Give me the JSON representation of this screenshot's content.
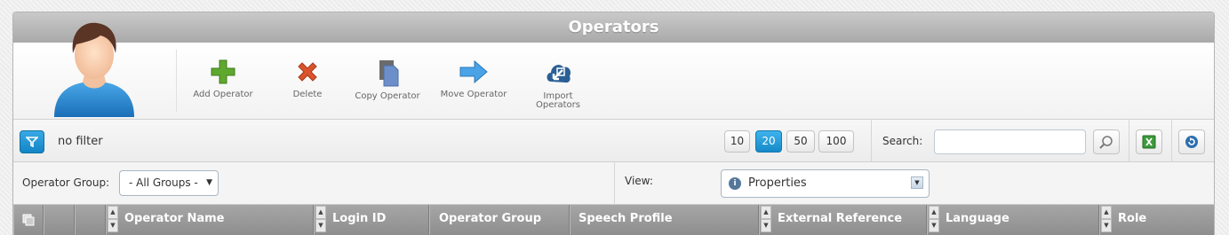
{
  "title": "Operators",
  "toolbar": {
    "add": "Add Operator",
    "delete": "Delete",
    "copy": "Copy Operator",
    "move": "Move Operator",
    "import": "Import Operators"
  },
  "filter": {
    "status": "no filter",
    "page_sizes": [
      "10",
      "20",
      "50",
      "100"
    ],
    "active_page_size": "20",
    "search_label": "Search:",
    "search_value": ""
  },
  "group": {
    "label": "Operator Group:",
    "selected": "- All Groups -"
  },
  "view": {
    "label": "View:",
    "selected": "Properties"
  },
  "columns": [
    "Operator Name",
    "Login ID",
    "Operator Group",
    "Speech Profile",
    "External Reference",
    "Language",
    "Role"
  ],
  "colors": {
    "accent": "#1a8fd0",
    "title_bar": "#b5b5b5",
    "header_row": "#999999",
    "add_icon": "#5fa82e",
    "delete_icon": "#d9532c"
  },
  "icons": {
    "avatar": "user-avatar-icon",
    "add": "plus-icon",
    "delete": "x-icon",
    "copy": "copy-icon",
    "move": "arrow-right-icon",
    "import": "import-icon",
    "filter": "funnel-icon",
    "search": "magnifier-icon",
    "excel": "excel-icon",
    "refresh": "refresh-icon"
  }
}
